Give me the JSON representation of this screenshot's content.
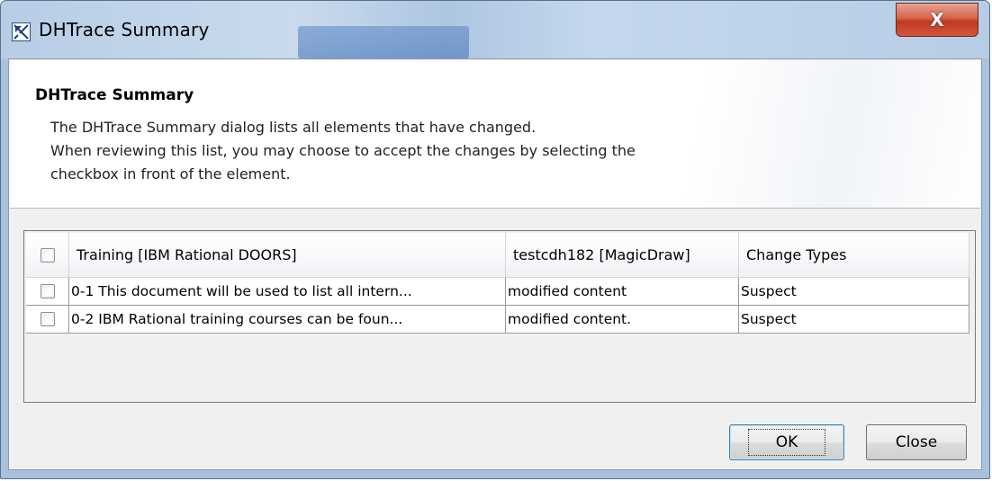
{
  "window": {
    "title": "DHTrace Summary",
    "close_glyph": "X"
  },
  "header": {
    "title": "DHTrace Summary",
    "description_lines": [
      "The DHTrace Summary dialog lists all elements that have changed.",
      "When reviewing this list, you may choose to accept the changes by selecting the",
      "checkbox in front of the element."
    ]
  },
  "table": {
    "columns": [
      "Training [IBM Rational DOORS]",
      "testcdh182 [MagicDraw]",
      "Change Types"
    ],
    "header_checked": false,
    "rows": [
      {
        "checked": false,
        "training": "0-1 This document will be used to list all intern...",
        "magicdraw": "modified content",
        "change_type": "Suspect"
      },
      {
        "checked": false,
        "training": "0-2 IBM Rational training courses can be foun...",
        "magicdraw": "modified content.",
        "change_type": "Suspect"
      }
    ]
  },
  "buttons": {
    "ok": "OK",
    "close": "Close"
  },
  "icons": {
    "title_icon": "dhtrace-app-icon",
    "close_icon": "close-window-icon",
    "checkbox": "checkbox-icon"
  },
  "colors": {
    "titlebar": "#b7cde6",
    "close_button": "#c0391f",
    "ok_focus": "#3c7fb1"
  }
}
